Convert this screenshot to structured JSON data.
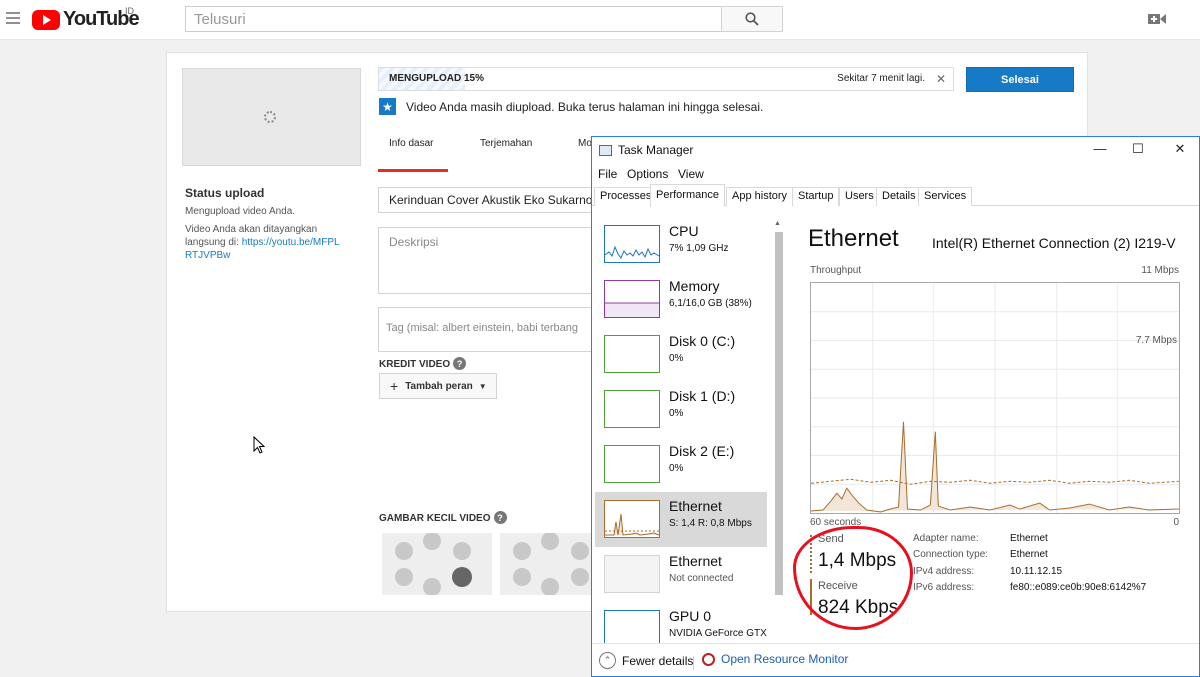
{
  "youtube": {
    "logo_text": "YouTube",
    "country_code": "ID",
    "search_placeholder": "Telusuri"
  },
  "upload": {
    "progress_label": "MENGUPLOAD 15%",
    "progress_fraction": 0.15,
    "time_remaining": "Sekitar 7 menit lagi.",
    "done_button": "Selesai",
    "notice_text": "Video Anda masih diupload. Buka terus halaman ini hingga selesai.",
    "status_title": "Status upload",
    "status_text": "Mengupload video Anda.",
    "publish_text": "Video Anda akan ditayangkan langsung di: ",
    "video_link": "https://youtu.be/MFPLRTJVPBw",
    "tabs": [
      "Info dasar",
      "Terjemahan",
      "Mo"
    ],
    "title_value": "Kerinduan Cover Akustik Eko Sukarno",
    "description_placeholder": "Deskripsi",
    "tags_placeholder": "Tag (misal: albert einstein, babi terbang",
    "credits_label": "KREDIT VIDEO",
    "add_role_button": "Tambah peran",
    "thumbnails_label": "GAMBAR KECIL VIDEO"
  },
  "task_manager": {
    "title": "Task Manager",
    "menu": [
      "File",
      "Options",
      "View"
    ],
    "tabs": [
      "Processes",
      "Performance",
      "App history",
      "Startup",
      "Users",
      "Details",
      "Services"
    ],
    "active_tab": "Performance",
    "resources": [
      {
        "name": "CPU",
        "detail": "7%  1,09 GHz",
        "color": "#1a75c2"
      },
      {
        "name": "Memory",
        "detail": "6,1/16,0 GB (38%)",
        "color": "#8b3aa8"
      },
      {
        "name": "Disk 0 (C:)",
        "detail": "0%",
        "color": "#4da033"
      },
      {
        "name": "Disk 1 (D:)",
        "detail": "0%",
        "color": "#4da033"
      },
      {
        "name": "Disk 2 (E:)",
        "detail": "0%",
        "color": "#4da033"
      },
      {
        "name": "Ethernet",
        "detail": "S: 1,4  R: 0,8 Mbps",
        "color": "#a86d2b"
      },
      {
        "name": "Ethernet",
        "detail": "Not connected",
        "color": "#a86d2b"
      },
      {
        "name": "GPU 0",
        "detail": "NVIDIA GeForce GTX",
        "color": "#1a75c2"
      }
    ],
    "detail": {
      "title": "Ethernet",
      "adapter": "Intel(R) Ethernet Connection (2) I219-V",
      "throughput_label": "Throughput",
      "max_label": "11 Mbps",
      "mid_label": "7.7 Mbps",
      "time_label": "60 seconds",
      "zero_label": "0",
      "send_label": "Send",
      "send_value": "1,4 Mbps",
      "receive_label": "Receive",
      "receive_value": "824 Kbps",
      "info": [
        {
          "key": "Adapter name:",
          "value": "Ethernet"
        },
        {
          "key": "Connection type:",
          "value": "Ethernet"
        },
        {
          "key": "IPv4 address:",
          "value": "10.11.12.15"
        },
        {
          "key": "IPv6 address:",
          "value": "fe80::e089:ce0b:90e8:6142%7"
        }
      ]
    },
    "fewer_details": "Fewer details",
    "resource_monitor": "Open Resource Monitor"
  }
}
